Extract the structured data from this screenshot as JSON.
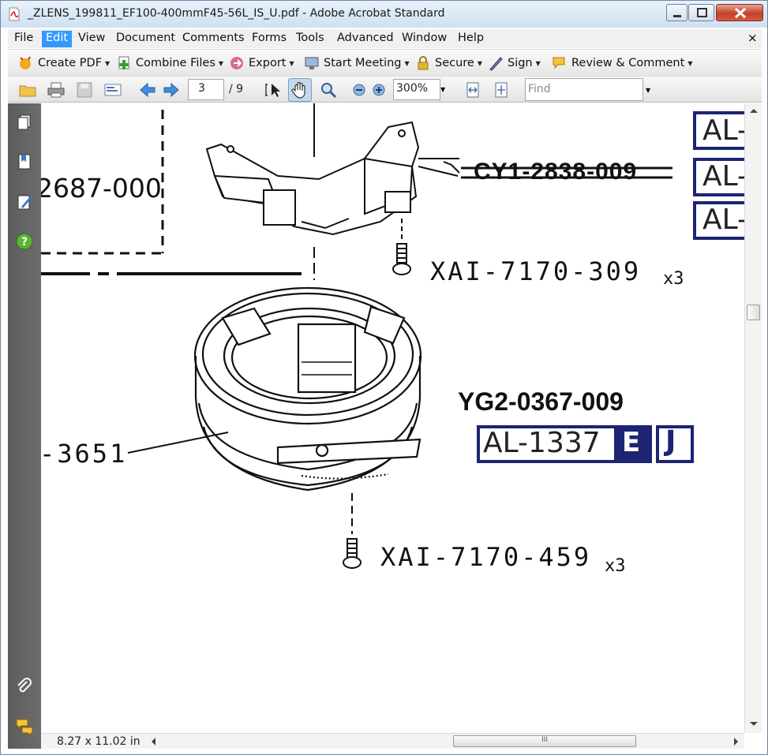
{
  "window": {
    "title": "_ZLENS_199811_EF100-400mmF45-56L_IS_U.pdf - Adobe Acrobat Standard",
    "controls": {
      "minimize_icon": "minimize-icon",
      "maximize_icon": "maximize-icon",
      "close_icon": "close-icon"
    }
  },
  "menu": {
    "items": [
      "File",
      "Edit",
      "View",
      "Document",
      "Comments",
      "Forms",
      "Tools",
      "Advanced",
      "Window",
      "Help"
    ],
    "active": "Edit",
    "doc_close": "×"
  },
  "toolbar": {
    "create_pdf": "Create PDF",
    "combine_files": "Combine Files",
    "export": "Export",
    "start_meeting": "Start Meeting",
    "secure": "Secure",
    "sign": "Sign",
    "review_comment": "Review & Comment"
  },
  "navigation": {
    "current_page": "3",
    "total_pages": "/ 9",
    "zoom": "300%",
    "find_placeholder": "Find"
  },
  "document": {
    "label_top_left": "2687-000",
    "label_struck": "CY1-2838-009",
    "label_screw_top": "XAI-7170-309",
    "label_screw_top_qty": "x3",
    "label_part": "YG2-0367-009",
    "al_code": "AL-1337",
    "badge_e": "E",
    "badge_j": "J",
    "label_left": "-3651",
    "label_screw_bottom": "XAI-7170-459",
    "label_screw_bottom_qty": "x3",
    "al_partial": [
      "AL-",
      "AL-",
      "AL-"
    ]
  },
  "status": {
    "page_size": "8.27 x 11.02 in",
    "hscroll_grip": "III"
  },
  "colors": {
    "accent_navy": "#1c2473",
    "menu_highlight": "#3399ff",
    "nav_panel": "#646464"
  }
}
